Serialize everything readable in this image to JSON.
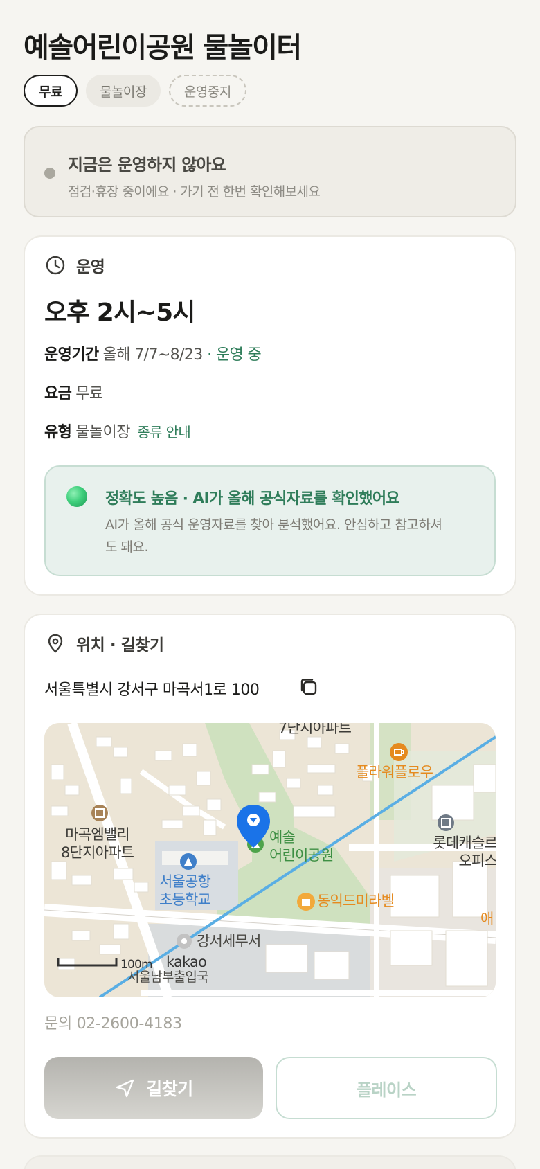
{
  "header": {
    "title": "예솔어린이공원 물놀이터",
    "chips": {
      "fee": "무료",
      "type": "물놀이장",
      "status": "운영중지"
    }
  },
  "status_notice": {
    "headline": "지금은 운영하지 않아요",
    "detail": "점검·휴장 중이에요 · 가기 전 한번 확인해보세요"
  },
  "hours": {
    "section_label": "운영",
    "time": "오후 2시~5시",
    "period_label": "운영기간",
    "period_value": "올해 7/7~8/23",
    "period_status": "· 운영 중",
    "fee_label": "요금",
    "fee_value": "무료",
    "type_label": "유형",
    "type_value": "물놀이장",
    "type_link": "종류 안내"
  },
  "ai_confidence": {
    "headline": "정확도 높음 · AI가 올해 공식자료를 확인했어요",
    "body": "AI가 올해 공식 운영자료를 찾아 분석했어요. 안심하고 참고하셔도 돼요."
  },
  "location": {
    "section_label": "위치 · 길찾기",
    "address": "서울특별시 강서구 마곡서1로 100",
    "contact": "문의 02-2600-4183",
    "map": {
      "labels": {
        "apt_top": "7단지아파트",
        "cafe": "플라워플로우",
        "park": "예솔\n어린이공원",
        "apt_left": "마곡엠밸리\n8단지아파트",
        "lotte": "롯데캐슬르\n오피스",
        "school": "서울공항\n초등학교",
        "mart": "동익드미라벨",
        "tax": "강서세무서",
        "edge_right": "애",
        "scale": "100m",
        "brand": "kakao",
        "cut_bottom": "서울남부출입국"
      }
    },
    "buttons": {
      "directions": "길찾기",
      "place": "플레이스"
    }
  },
  "colors": {
    "accent_green": "#2f7d5a",
    "map_pin": "#1a73e8",
    "map_poi_orange": "#e58a1f",
    "map_school_blue": "#3f7fc9"
  },
  "icons": [
    "clock-icon",
    "location-pin-icon",
    "copy-icon",
    "navigation-arrow-icon"
  ]
}
